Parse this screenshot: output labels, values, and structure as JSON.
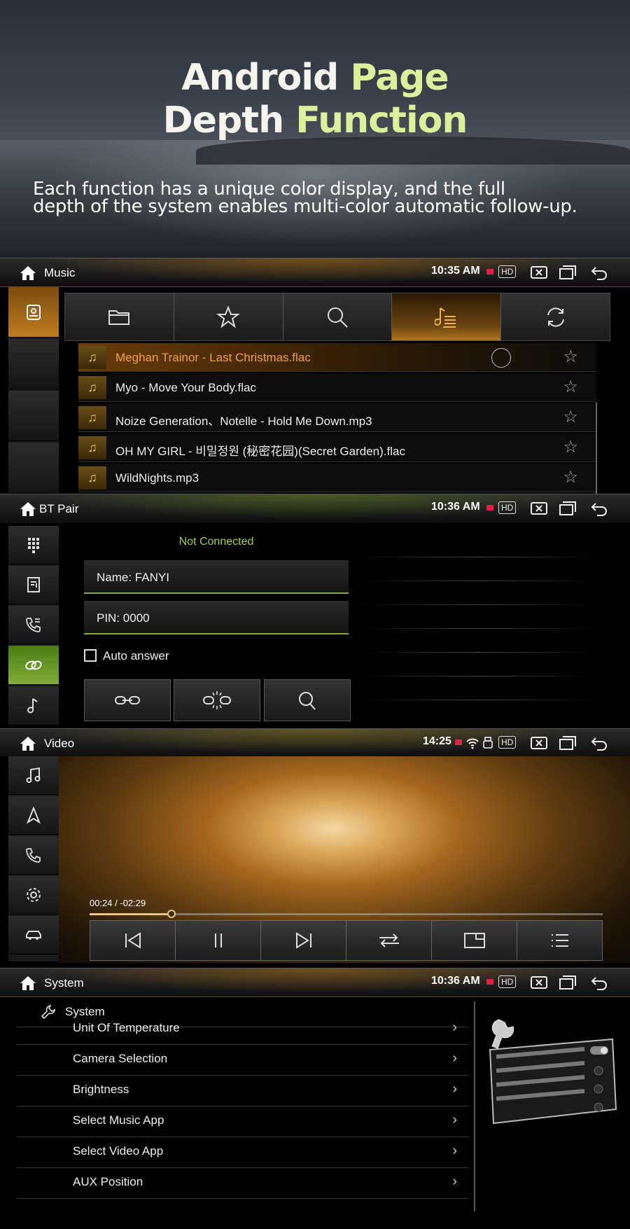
{
  "hero": {
    "title_line1_white": "Android",
    "title_line1_green": "Page",
    "title_line2_white": "Depth",
    "title_line2_green": "Function",
    "subtitle_line1": "Each function has a unique color display, and the full",
    "subtitle_line2": "depth of the system enables multi-color automatic follow-up."
  },
  "status_icons": [
    "home-icon",
    "hd-badge",
    "close-screen-icon",
    "window-icon",
    "back-icon"
  ],
  "music": {
    "title": "Music",
    "time": "10:35 AM",
    "hd": "HD",
    "accent": "#c8801e",
    "tabs": [
      "folder-icon",
      "star-icon",
      "search-icon",
      "playlist-icon",
      "repeat-icon"
    ],
    "active_tab": 3,
    "tracks": [
      {
        "title": "Meghan Trainor - Last Christmas.flac",
        "playing": true
      },
      {
        "title": "Myo - Move Your Body.flac",
        "playing": false
      },
      {
        "title": "Noize Generation、Notelle - Hold Me Down.mp3",
        "playing": false
      },
      {
        "title": "OH MY GIRL - 비밀정원 (秘密花园)(Secret Garden).flac",
        "playing": false
      },
      {
        "title": "WildNights.mp3",
        "playing": false
      }
    ]
  },
  "bt": {
    "title": "BT Pair",
    "time": "10:36 AM",
    "hd": "HD",
    "accent": "#7fae3a",
    "status": "Not Connected",
    "name_field": "Name:  FANYI",
    "pin_field": "PIN:  0000",
    "auto_answer": "Auto answer",
    "side_items": [
      "dialpad-icon",
      "contacts-icon",
      "call-log-icon",
      "link-icon",
      "music-note-icon"
    ],
    "active_side": 3
  },
  "video": {
    "title": "Video",
    "time": "14:25",
    "hd": "HD",
    "progress_text": "00:24 / -02:29",
    "progress": 0.16,
    "controls": [
      "previous-icon",
      "pause-icon",
      "next-icon",
      "shuffle-icon",
      "window-mode-icon",
      "list-icon"
    ]
  },
  "system": {
    "title": "System",
    "time": "10:36 AM",
    "hd": "HD",
    "section": "System",
    "items": [
      "Unit Of Temperature",
      "Camera Selection",
      "Brightness",
      "Select Music App",
      "Select Video App",
      "AUX Position"
    ]
  }
}
